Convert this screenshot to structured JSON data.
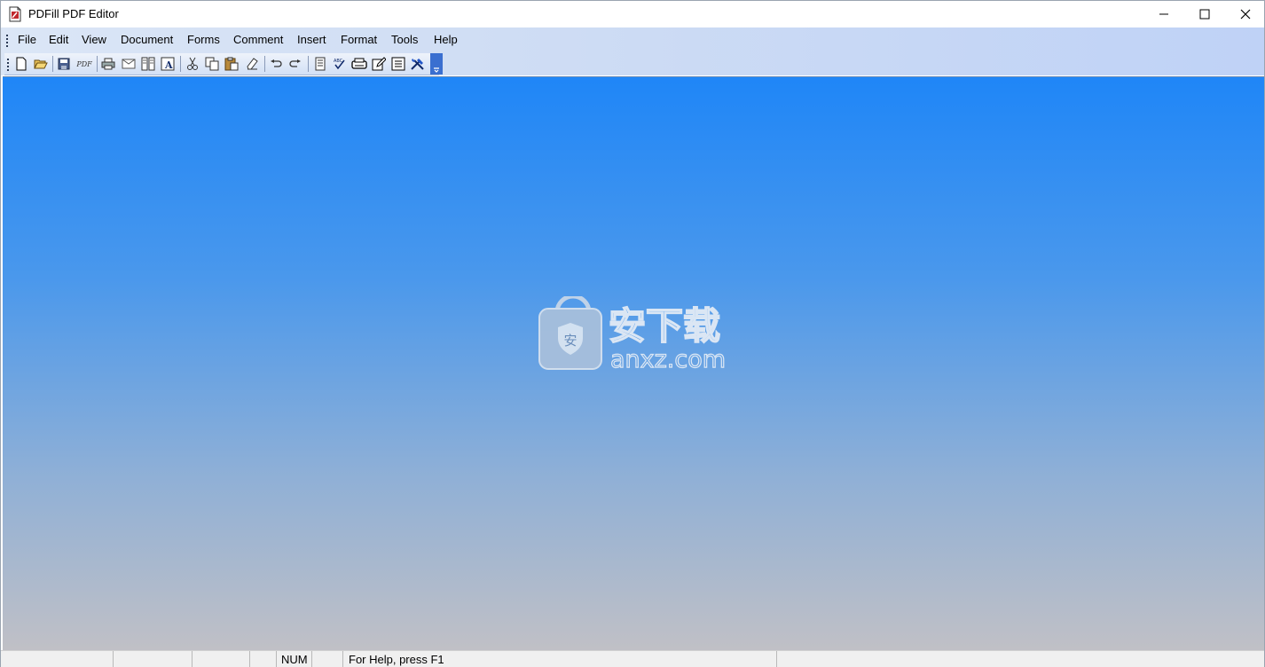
{
  "window": {
    "title": "PDFill PDF Editor"
  },
  "menu": [
    "File",
    "Edit",
    "View",
    "Document",
    "Forms",
    "Comment",
    "Insert",
    "Format",
    "Tools",
    "Help"
  ],
  "toolbar": {
    "buttons": [
      "new-icon",
      "open-icon",
      "save-icon",
      "save-pdf-icon",
      "print-icon",
      "email-icon",
      "page-layout-icon",
      "text-format-icon",
      "cut-icon",
      "copy-icon",
      "paste-icon",
      "eraser-icon",
      "undo-icon",
      "redo-icon",
      "document-icon",
      "spell-check-icon",
      "scan-icon",
      "edit-icon",
      "form-list-icon",
      "tools-icon"
    ],
    "pdf_label": "PDF",
    "abc_label": "ABC"
  },
  "watermark": {
    "text": "安下载",
    "domain": "anxz.com",
    "badge": "安"
  },
  "status": {
    "num": "NUM",
    "help": "For Help, press F1"
  },
  "colors": {
    "workspace_top": "#1f86f7",
    "workspace_bottom": "#c0c0c6",
    "menubar": "#cfddf4"
  }
}
